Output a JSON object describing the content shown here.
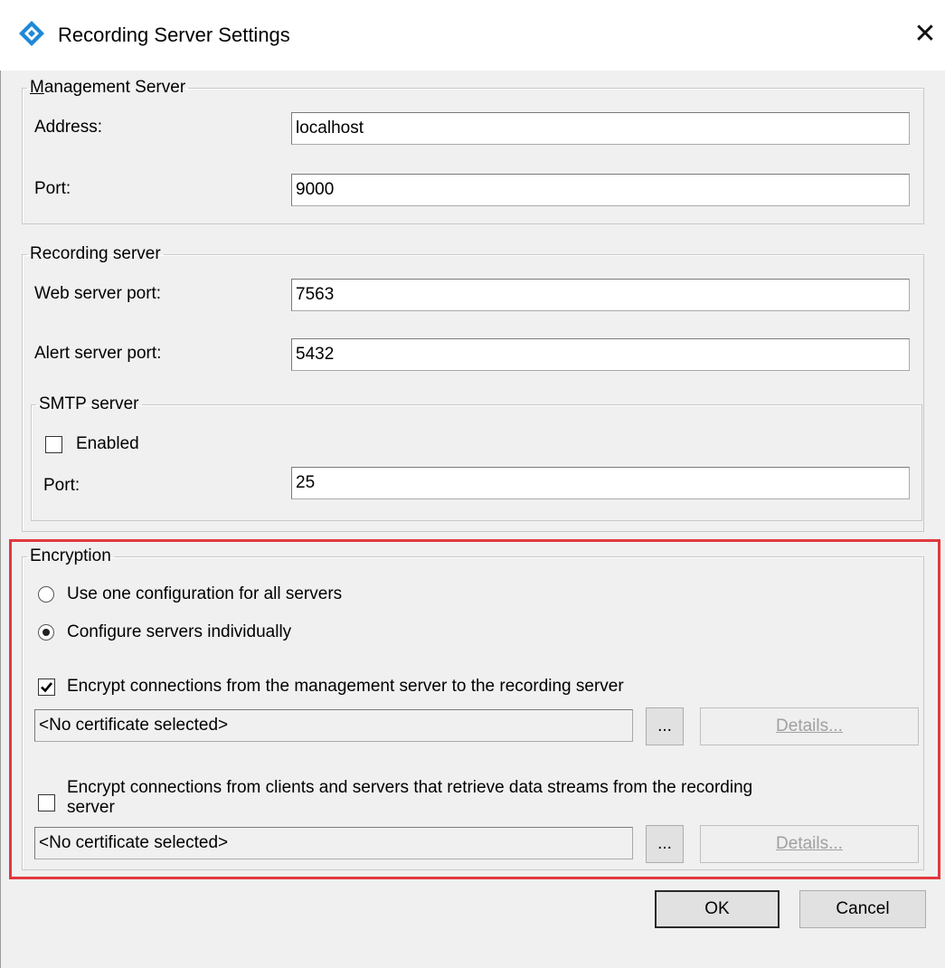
{
  "window": {
    "title": "Recording Server Settings",
    "icon": "diamond-app-icon",
    "close_glyph": "✕"
  },
  "management_server": {
    "legend": "Management Server",
    "address_label": "Address:",
    "address_value": "localhost",
    "port_label": "Port:",
    "port_value": "9000"
  },
  "recording_server": {
    "legend": "Recording server",
    "web_port_label": "Web server port:",
    "web_port_value": "7563",
    "alert_port_label": "Alert server port:",
    "alert_port_value": "5432",
    "smtp": {
      "legend": "SMTP server",
      "enabled_label": "Enabled",
      "enabled_checked": false,
      "port_label": "Port:",
      "port_value": "25"
    }
  },
  "encryption": {
    "legend": "Encryption",
    "radio_one": "Use one configuration for all servers",
    "radio_individual": "Configure servers individually",
    "selected_radio": "Configure servers individually",
    "mgmt_to_recording": {
      "label": "Encrypt connections from the management server to the recording server",
      "checked": true,
      "certificate": "<No certificate selected>",
      "browse": "...",
      "details": "Details..."
    },
    "clients_to_recording": {
      "label_line1": "Encrypt connections from clients and servers that retrieve data streams from the recording",
      "label_line2": "server",
      "checked": false,
      "certificate": "<No certificate selected>",
      "browse": "...",
      "details": "Details..."
    }
  },
  "buttons": {
    "ok": "OK",
    "cancel": "Cancel"
  },
  "colors": {
    "highlight": "#e0383f",
    "icon_blue": "#1e88d8"
  }
}
